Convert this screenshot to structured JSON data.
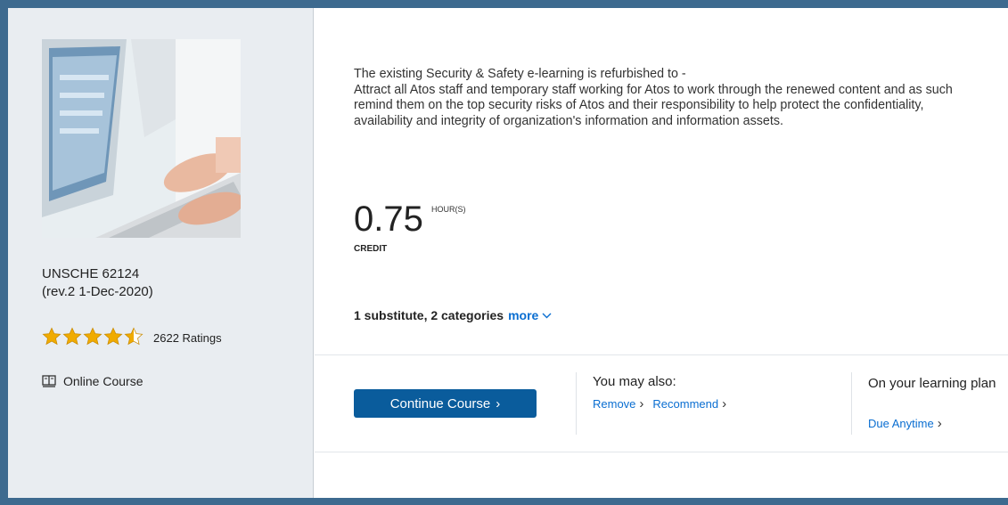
{
  "course": {
    "id": "UNSCHE 62124",
    "revision": "(rev.2 1-Dec-2020)",
    "rating": 4.5,
    "rating_count": "2622 Ratings",
    "type_label": "Online Course",
    "type_icon": "book-icon"
  },
  "description": "The existing Security & Safety e-learning is refurbished to -\nAttract all Atos staff and temporary staff working for Atos to work through the renewed content and as such remind them on the top security risks of Atos and their responsibility to help protect the confidentiality, availability and integrity of organization's information and information assets.",
  "credit": {
    "value": "0.75",
    "unit": "HOUR(S)",
    "label": "CREDIT"
  },
  "substitutes": {
    "text": "1 substitute, 2 categories",
    "more_label": "more"
  },
  "actions": {
    "continue_label": "Continue Course",
    "may_also_label": "You may also:",
    "remove_label": "Remove",
    "recommend_label": "Recommend",
    "plan_label": "On your learning plan",
    "due_label": "Due Anytime"
  },
  "colors": {
    "frame": "#3d6a8f",
    "star": "#f0ab00",
    "link": "#0a6ed1",
    "button": "#0a5c9c"
  }
}
